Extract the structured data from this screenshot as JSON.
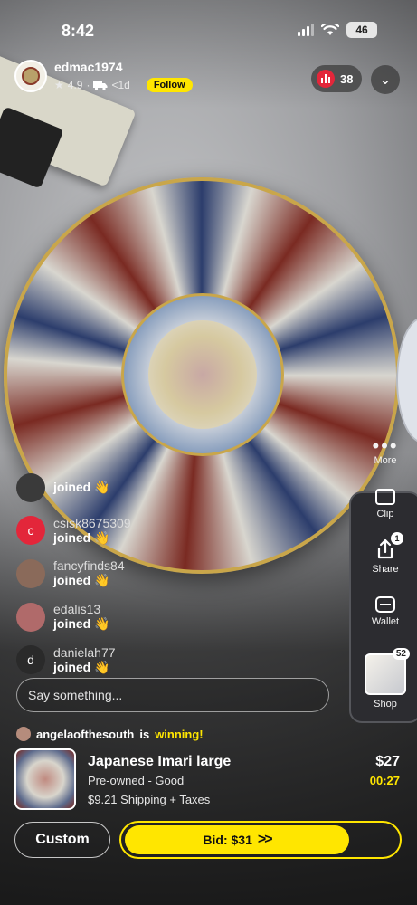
{
  "status_bar": {
    "time": "8:42",
    "battery": "46"
  },
  "host": {
    "username": "edmac1974",
    "rating": "4.9",
    "shipping": "<1d",
    "follow_label": "Follow"
  },
  "viewers": {
    "count": "38"
  },
  "right_rail": {
    "more_label": "More",
    "clip_label": "Clip",
    "share_label": "Share",
    "share_badge": "1",
    "wallet_label": "Wallet",
    "shop_label": "Shop",
    "shop_badge": "52"
  },
  "chat": [
    {
      "user": "",
      "message": "joined 👋",
      "avatar_letter": "",
      "avatar_color": "#3a3a3a"
    },
    {
      "user": "csisk8675309",
      "message": "joined 👋",
      "avatar_letter": "c",
      "avatar_color": "#e3263a"
    },
    {
      "user": "fancyfinds84",
      "message": "joined 👋",
      "avatar_letter": "",
      "avatar_color": "#8a6a5a"
    },
    {
      "user": "edalis13",
      "message": "joined 👋",
      "avatar_letter": "",
      "avatar_color": "#b06a6a"
    },
    {
      "user": "danielah77",
      "message": "joined 👋",
      "avatar_letter": "d",
      "avatar_color": "#2a2a2a"
    }
  ],
  "input": {
    "placeholder": "Say something..."
  },
  "auction": {
    "winner": "angelaofthesouth",
    "winning_text": "is",
    "winning_highlight": "winning!",
    "title": "Japanese Imari large",
    "condition": "Pre-owned - Good",
    "shipping": "$9.21 Shipping + Taxes",
    "price": "$27",
    "time_left": "00:27"
  },
  "actions": {
    "custom_label": "Custom",
    "bid_label": "Bid: $31",
    "bid_arrows": ">>"
  },
  "colors": {
    "accent": "#ffe600",
    "live_red": "#e3263a"
  }
}
